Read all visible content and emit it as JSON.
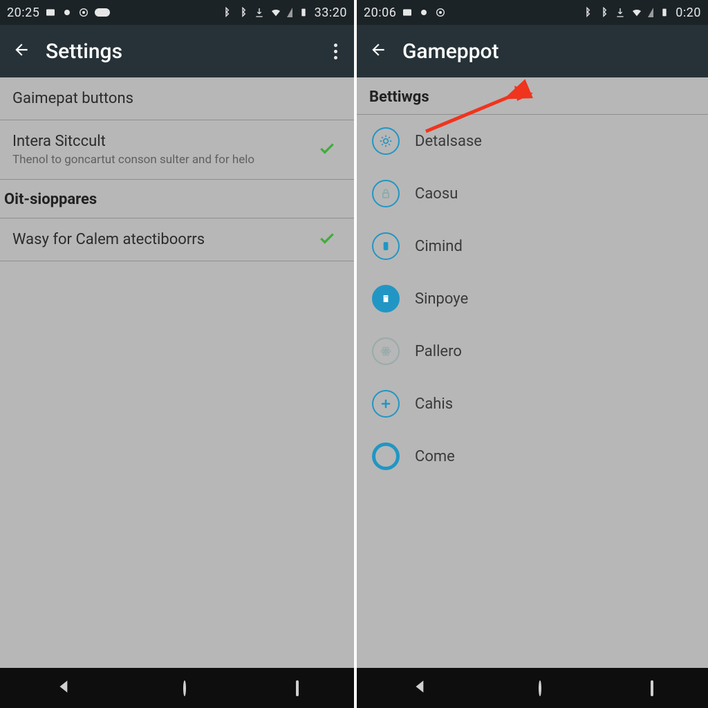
{
  "left": {
    "status": {
      "time_left": "20:25",
      "time_right": "33:20"
    },
    "title": "Settings",
    "rows": {
      "r0": {
        "primary": "Gaimepat buttons"
      },
      "r1": {
        "primary": "Intera Sitccult",
        "secondary": "Thenol to goncartut conson sulter and for helo"
      },
      "header1": "Oit-sioppares",
      "r2": {
        "primary": "Wasy for Calem atectiboorrs"
      }
    }
  },
  "right": {
    "status": {
      "time_left": "20:06",
      "time_right": "0:20"
    },
    "title": "Gameppot",
    "section": "Bettiwgs",
    "items": {
      "i0": "Detalsase",
      "i1": "Caosu",
      "i2": "Cimind",
      "i3": "Sinpoye",
      "i4": "Pallero",
      "i5": "Cahis",
      "i6": "Come"
    }
  },
  "colors": {
    "accent": "#2196c4",
    "check": "#3fae3a",
    "arrow": "#f0341e"
  }
}
